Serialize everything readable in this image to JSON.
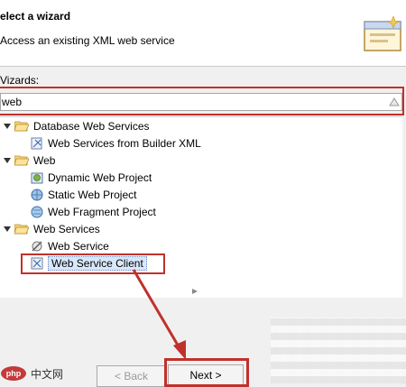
{
  "header": {
    "title": "elect a wizard",
    "description": "Access an existing XML web service"
  },
  "wizards_label": "Vizards:",
  "filter": {
    "value": "web"
  },
  "tree": {
    "items": [
      {
        "label": "Database Web Services"
      },
      {
        "label": "Web Services from Builder XML"
      },
      {
        "label": "Web"
      },
      {
        "label": "Dynamic Web Project"
      },
      {
        "label": "Static Web Project"
      },
      {
        "label": "Web Fragment Project"
      },
      {
        "label": "Web Services"
      },
      {
        "label": "Web Service"
      },
      {
        "label": "Web Service Client"
      }
    ]
  },
  "buttons": {
    "back": "< Back",
    "next": "Next >"
  },
  "watermark": {
    "text": "中文网"
  },
  "colors": {
    "annotation_red": "#c0312c",
    "selection_bg": "#d8e8fb"
  }
}
